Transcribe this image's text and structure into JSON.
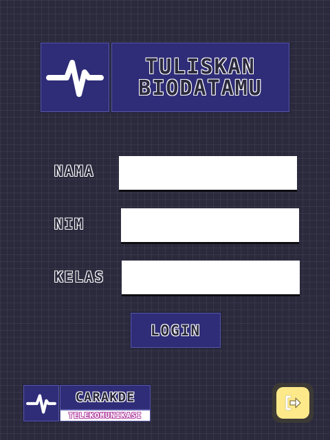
{
  "header": {
    "title_line1": "TULISKAN",
    "title_line2": "BIODATAMU",
    "logo_icon": "heartbeat-pulse-icon"
  },
  "form": {
    "fields": [
      {
        "label": "NAMA",
        "value": "",
        "placeholder": ""
      },
      {
        "label": "NIM",
        "value": "",
        "placeholder": ""
      },
      {
        "label": "KELAS",
        "value": "",
        "placeholder": ""
      }
    ],
    "login_label": "LOGIN"
  },
  "footer": {
    "brand_name": "CARAKDE",
    "brand_tagline": "TELEKOMUNIKASI",
    "logo_icon": "heartbeat-pulse-icon",
    "exit_icon": "exit-door-icon"
  },
  "colors": {
    "background": "#2b2a3d",
    "panel": "#2f2d78",
    "exit_button": "#fde98a",
    "tagline": "#b23ea0"
  }
}
